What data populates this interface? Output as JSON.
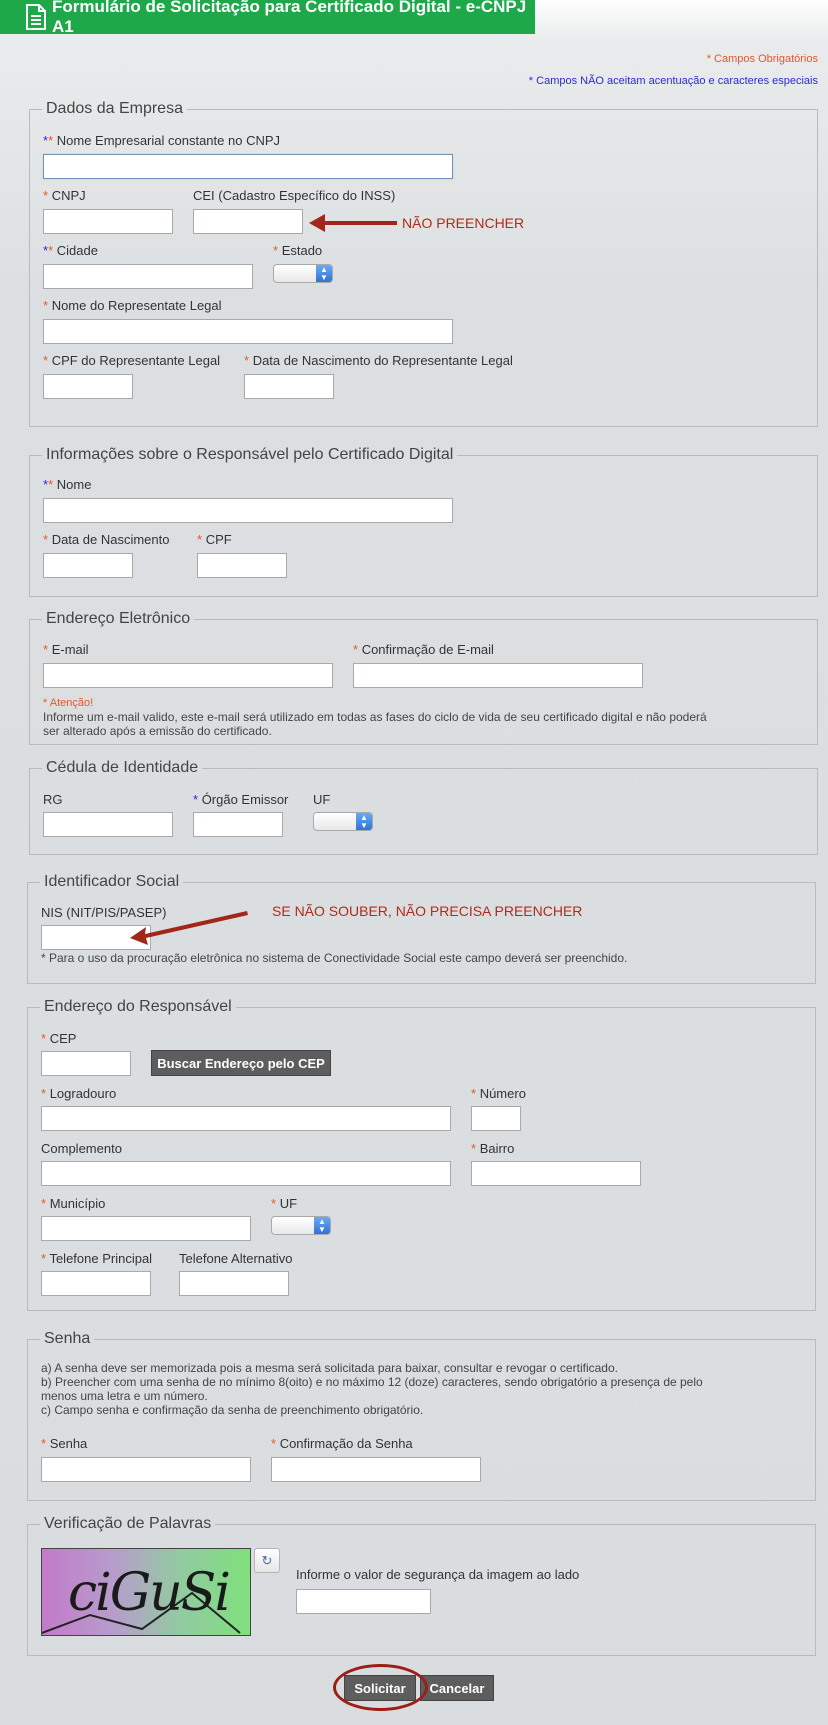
{
  "header": {
    "title": "Formulário de Solicitação para Certificado Digital - e-CNPJ A1"
  },
  "legend": {
    "required": "* Campos Obrigatórios",
    "no_accent": "* Campos NÃO aceitam acentuação e caracteres especiais"
  },
  "empresa": {
    "title": "Dados da Empresa",
    "nome_label": "Nome Empresarial constante no CNPJ",
    "cnpj_label": "CNPJ",
    "cei_label": "CEI (Cadastro Específico do INSS)",
    "cei_annotation": "NÃO PREENCHER",
    "cidade_label": "Cidade",
    "estado_label": "Estado",
    "rep_label": "Nome do Representate Legal",
    "cpf_rep_label": "CPF do Representante Legal",
    "nasc_rep_label": "Data de Nascimento do Representante Legal"
  },
  "responsavel": {
    "title": "Informações sobre o Responsável pelo Certificado Digital",
    "nome_label": "Nome",
    "nasc_label": "Data de Nascimento",
    "cpf_label": "CPF"
  },
  "email": {
    "title": "Endereço Eletrônico",
    "email_label": "E-mail",
    "confirm_label": "Confirmação de E-mail",
    "attention": "* Atenção!",
    "notice_line1": "Informe um e-mail valido, este e-mail será utilizado em todas as fases do ciclo de vida de seu certificado digital e não poderá",
    "notice_line2": "ser alterado após a emissão do certificado."
  },
  "identidade": {
    "title": "Cédula de Identidade",
    "rg_label": "RG",
    "orgao_label": "Órgão Emissor",
    "uf_label": "UF"
  },
  "social": {
    "title": "Identificador Social",
    "nis_label": "NIS (NIT/PIS/PASEP)",
    "annotation": "SE NÃO SOUBER, NÃO PRECISA PREENCHER",
    "note": "* Para o uso da procuração eletrônica no sistema de Conectividade Social este campo deverá ser preenchido."
  },
  "endereco": {
    "title": "Endereço do Responsável",
    "cep_label": "CEP",
    "buscar_button": "Buscar Endereço pelo CEP",
    "logradouro_label": "Logradouro",
    "numero_label": "Número",
    "complemento_label": "Complemento",
    "bairro_label": "Bairro",
    "municipio_label": "Município",
    "uf_label": "UF",
    "tel_principal_label": "Telefone Principal",
    "tel_alt_label": "Telefone Alternativo"
  },
  "senha": {
    "title": "Senha",
    "rule_a": "a) A senha deve ser memorizada pois a mesma será solicitada para baixar, consultar e revogar o certificado.",
    "rule_b1": "b) Preencher com uma senha de no mínimo 8(oito) e no máximo 12 (doze) caracteres, sendo obrigatório a presença de pelo",
    "rule_b2": "menos uma letra e um número.",
    "rule_c": "c) Campo senha e confirmação da senha de preenchimento obrigatório.",
    "senha_label": "Senha",
    "confirm_label": "Confirmação da Senha"
  },
  "verificacao": {
    "title": "Verificação de Palavras",
    "captcha_text": "ciGuSi",
    "instruction": "Informe o valor de segurança da imagem ao lado"
  },
  "actions": {
    "submit": "Solicitar",
    "cancel": "Cancelar"
  },
  "colors": {
    "header": "#1fa84a",
    "required": "#e8572a",
    "accent_blue": "#2b2bd8",
    "annotation": "#b12a1a"
  }
}
